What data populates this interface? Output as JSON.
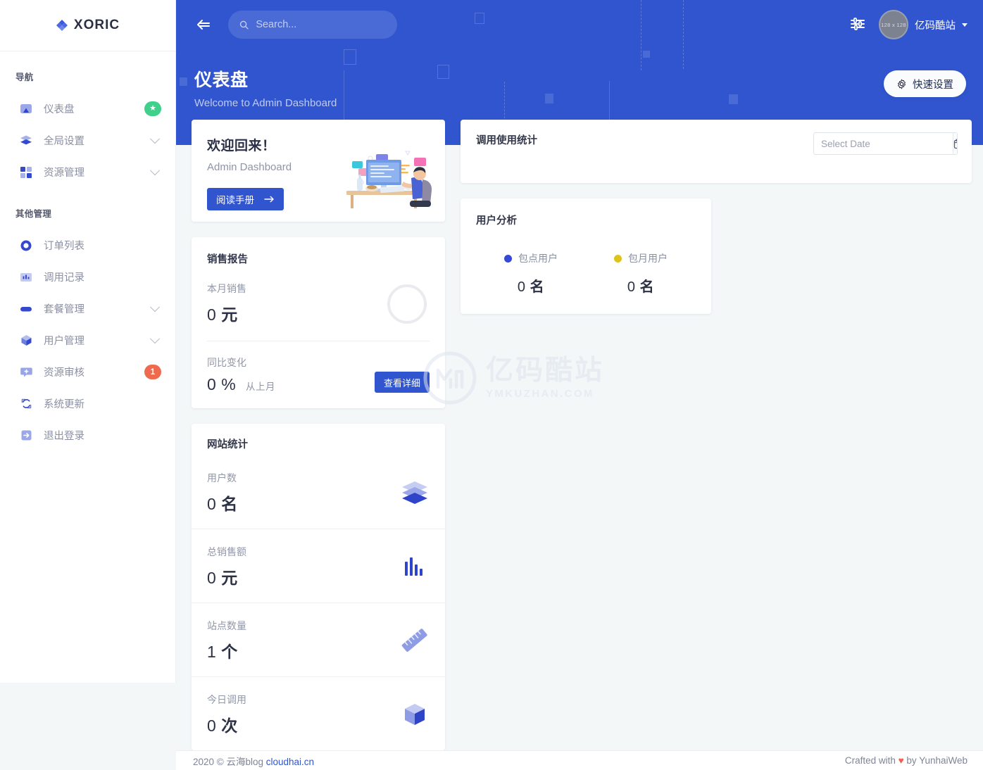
{
  "brand": {
    "name": "XORIC"
  },
  "sidebar": {
    "group1_title": "导航",
    "group2_title": "其他管理",
    "nav": [
      {
        "label": "仪表盘",
        "icon": "dashboard-icon",
        "badge": "★",
        "badge_color": "#3fd08b",
        "has_chevron": false
      },
      {
        "label": "全局设置",
        "icon": "layers-icon",
        "has_chevron": true
      },
      {
        "label": "资源管理",
        "icon": "grid-icon",
        "has_chevron": true
      }
    ],
    "other": [
      {
        "label": "订单列表",
        "icon": "circle-icon",
        "has_chevron": false
      },
      {
        "label": "调用记录",
        "icon": "bar-chart-icon",
        "has_chevron": false
      },
      {
        "label": "套餐管理",
        "icon": "pill-icon",
        "has_chevron": true
      },
      {
        "label": "用户管理",
        "icon": "cube-icon",
        "has_chevron": true
      },
      {
        "label": "资源审核",
        "icon": "chat-plus-icon",
        "badge": "1",
        "badge_color": "#ed6a4f",
        "has_chevron": false
      },
      {
        "label": "系统更新",
        "icon": "refresh-icon",
        "has_chevron": false
      },
      {
        "label": "退出登录",
        "icon": "logout-icon",
        "has_chevron": false
      }
    ]
  },
  "topbar": {
    "search_placeholder": "Search...",
    "user_name": "亿码酷站",
    "avatar_text": "128 x 128",
    "page_title": "仪表盘",
    "page_subtitle": "Welcome to Admin Dashboard",
    "quick_settings": "快速设置"
  },
  "welcome": {
    "title": "欢迎回来！",
    "subtitle": "Admin Dashboard",
    "button": "阅读手册"
  },
  "sales": {
    "title": "销售报告",
    "month_label": "本月销售",
    "month_value": "0",
    "month_unit": "元",
    "change_label": "同比变化",
    "change_value": "0",
    "change_unit": "%",
    "change_note": "从上月",
    "detail_button": "查看详细"
  },
  "site_stats": {
    "title": "网站统计",
    "rows": [
      {
        "label": "用户数",
        "value": "0",
        "unit": "名",
        "icon": "layers-3d-icon"
      },
      {
        "label": "总销售额",
        "value": "0",
        "unit": "元",
        "icon": "bar-chart-icon"
      },
      {
        "label": "站点数量",
        "value": "1",
        "unit": "个",
        "icon": "ruler-icon"
      },
      {
        "label": "今日调用",
        "value": "0",
        "unit": "次",
        "icon": "cube-3d-icon"
      }
    ]
  },
  "usage": {
    "title": "调用使用统计",
    "date_placeholder": "Select Date"
  },
  "analysis": {
    "title": "用户分析",
    "items": [
      {
        "label": "包点用户",
        "value": "0",
        "unit": "名",
        "color": "#3449d8"
      },
      {
        "label": "包月用户",
        "value": "0",
        "unit": "名",
        "color": "#e0c318"
      }
    ]
  },
  "footer": {
    "left_prefix": "2020 © 云海blog ",
    "left_link": "cloudhai.cn",
    "right_prefix": "Crafted with ",
    "right_heart": "♥",
    "right_suffix": " by YunhaiWeb"
  },
  "watermark": {
    "zh": "亿码酷站",
    "en": "YMKUZHAN.COM"
  },
  "colors": {
    "primary": "#3055cf",
    "bg": "#f3f7f8",
    "accent_green": "#3fd08b",
    "accent_red": "#ed6a4f"
  }
}
